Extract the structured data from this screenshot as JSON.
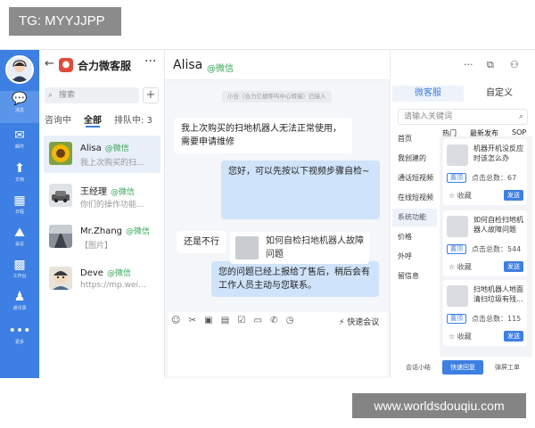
{
  "watermark_top": "TG: MYYJJPP",
  "watermark_bottom": "www.worldsdouqiu.com",
  "rail": {
    "items": [
      {
        "icon": "💬",
        "label": "消息"
      },
      {
        "icon": "✉",
        "label": "邮件"
      },
      {
        "icon": "⬆",
        "label": "文档"
      },
      {
        "icon": "▦",
        "label": "日程"
      },
      {
        "icon": "⛰",
        "label": "会议"
      },
      {
        "icon": "▩",
        "label": "工作台"
      },
      {
        "icon": "♟",
        "label": "通讯录"
      },
      {
        "icon": "•••",
        "label": "更多"
      }
    ]
  },
  "contact_panel": {
    "brand": "合力微客服",
    "search_placeholder": "搜索",
    "tabs": [
      "咨询中",
      "全部",
      "排队中: 3"
    ],
    "conversations": [
      {
        "name": "Alisa",
        "source": "@微信",
        "preview": "我上次购买的扫..."
      },
      {
        "name": "王经理",
        "source": "@微信",
        "preview": "你们的操作功能..."
      },
      {
        "name": "Mr.Zhang",
        "source": "@微信",
        "preview": "【图片】"
      },
      {
        "name": "Deve",
        "source": "@微信",
        "preview": "https://mp.wei..."
      }
    ]
  },
  "chat": {
    "title": "Alisa",
    "source": "@微信",
    "system_notice": "小合（合力亿捷呼叫中心转接）已接入",
    "messages": [
      {
        "side": "left",
        "text": "我上次购买的扫地机器人无法正常使用，需要申请维修"
      },
      {
        "side": "right",
        "text": "您好，可以先按以下视频步骤自检~"
      },
      {
        "side": "right",
        "card": "如何自检扫地机器人故障问题"
      },
      {
        "side": "left",
        "text": "还是不行"
      },
      {
        "side": "right",
        "text": "您的问题已经上报给了售后，稍后会有工作人员主动与您联系。"
      }
    ],
    "toolbar_meet": "快速会议"
  },
  "side_panel": {
    "tabs": [
      "微客服",
      "自定义"
    ],
    "search_placeholder": "请输入关键词",
    "categories": [
      "首页",
      "我创建的",
      "通话短视频",
      "在线短视频",
      "系统功能",
      "价格",
      "外呼",
      "留信息"
    ],
    "sub_tabs": [
      "热门",
      "最新发布",
      "SOP"
    ],
    "items": [
      {
        "title": "机器开机没反应时该怎么办",
        "tag": "置顶",
        "clicks": "点击总数：67",
        "fav": "收藏",
        "send": "发送"
      },
      {
        "title": "如何自检扫地机器人故障问题",
        "tag": "置顶",
        "clicks": "点击总数：544",
        "fav": "收藏",
        "send": "发送"
      },
      {
        "title": "扫地机器人地面清扫垃圾有残...",
        "tag": "置顶",
        "clicks": "点击总数：115",
        "fav": "收藏",
        "send": "发送"
      }
    ],
    "bottom_tabs": [
      "会话小结",
      "快速回复",
      "弹屏工单"
    ]
  }
}
